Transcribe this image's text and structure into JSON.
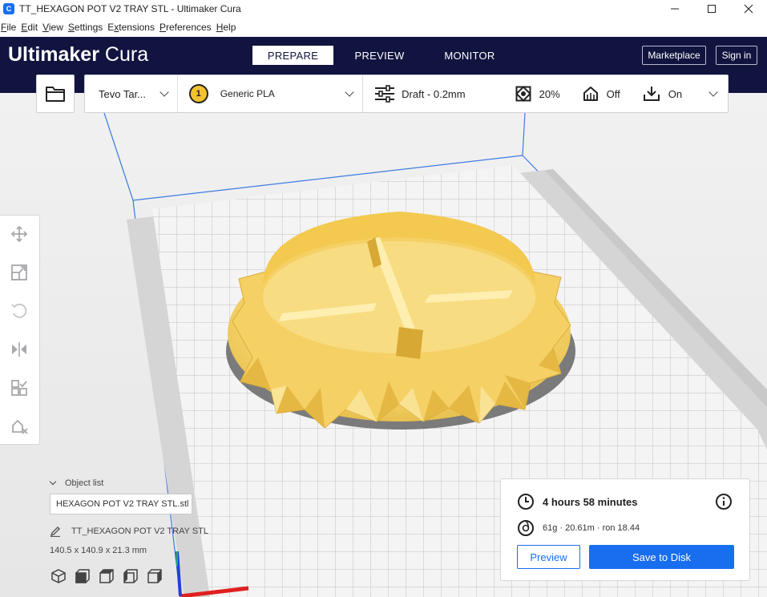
{
  "window": {
    "title": "TT_HEXAGON POT V2 TRAY STL - Ultimaker Cura",
    "app_icon_letter": "C"
  },
  "menu": [
    {
      "label": "File",
      "mnemonic": "F"
    },
    {
      "label": "Edit",
      "mnemonic": "E"
    },
    {
      "label": "View",
      "mnemonic": "V"
    },
    {
      "label": "Settings",
      "mnemonic": "S"
    },
    {
      "label": "Extensions",
      "mnemonic": "x"
    },
    {
      "label": "Preferences",
      "mnemonic": "P"
    },
    {
      "label": "Help",
      "mnemonic": "H"
    }
  ],
  "header": {
    "brand_bold": "Ultimaker",
    "brand_light": "Cura",
    "stages": [
      "PREPARE",
      "PREVIEW",
      "MONITOR"
    ],
    "active_stage": "PREPARE",
    "marketplace_label": "Marketplace",
    "signin_label": "Sign in"
  },
  "toolbar": {
    "printer": "Tevo Tar...",
    "extruder_number": "1",
    "material": "Generic PLA",
    "profile": "Draft - 0.2mm",
    "infill": "20%",
    "support": "Off",
    "adhesion": "On"
  },
  "object_list": {
    "heading": "Object list",
    "selected_object": "HEXAGON POT V2 TRAY STL.stl",
    "file_name": "TT_HEXAGON POT V2 TRAY STL",
    "dimensions": "140.5 x 140.9 x 21.3 mm"
  },
  "print_info": {
    "time": "4 hours 58 minutes",
    "material_usage": "61g · 20.61m · ron 18.44",
    "preview_label": "Preview",
    "save_label": "Save to Disk"
  },
  "colors": {
    "header_bg": "#121440",
    "accent": "#196ef0",
    "model": "#f7d56a",
    "build_plate": "#f4f4f4"
  }
}
